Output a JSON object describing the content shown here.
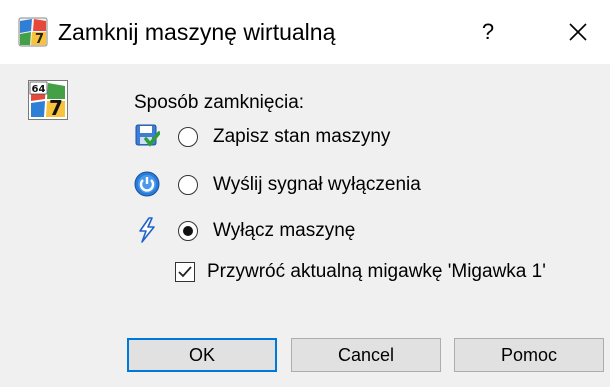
{
  "dialog": {
    "title": "Zamknij maszynę wirtualną",
    "help_label": "?"
  },
  "group_label": "Sposób zamknięcia:",
  "options": [
    {
      "label": "Zapisz stan maszyny",
      "selected": false
    },
    {
      "label": "Wyślij sygnał wyłączenia",
      "selected": false
    },
    {
      "label": "Wyłącz maszynę",
      "selected": true
    }
  ],
  "restore_snapshot": {
    "label": "Przywróć aktualną migawkę 'Migawka 1'",
    "checked": true
  },
  "buttons": {
    "ok": "OK",
    "cancel": "Cancel",
    "help": "Pomoc"
  },
  "vm_icon_text": "64",
  "colors": {
    "accent": "#0078d7",
    "background": "#f0f0f0",
    "titlebar": "#ffffff"
  }
}
